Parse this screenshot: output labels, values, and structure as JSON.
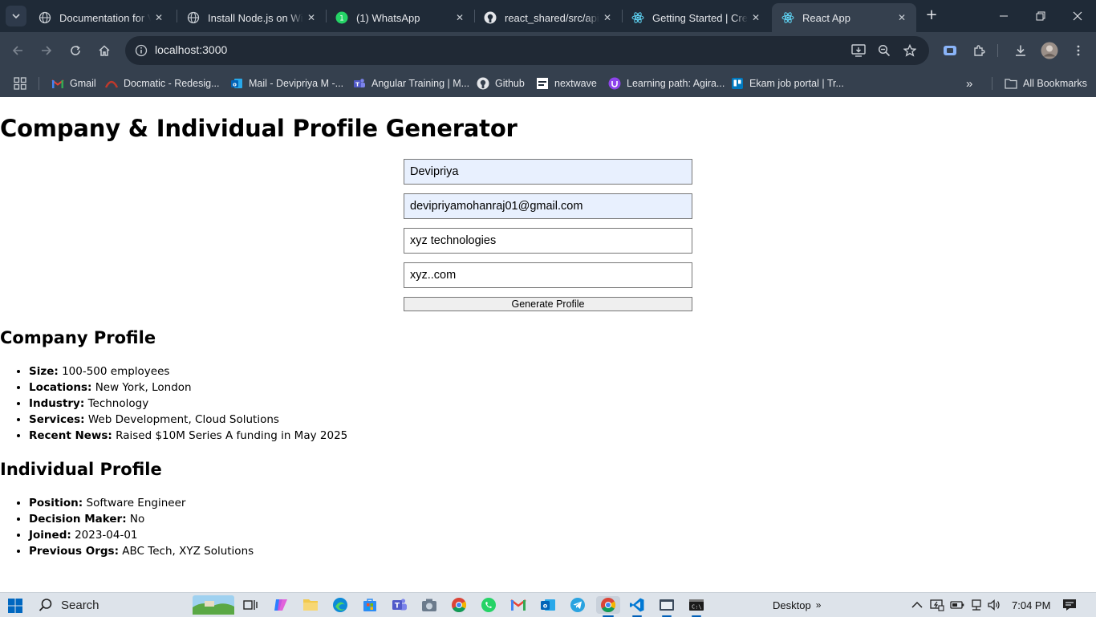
{
  "browser": {
    "tabs": [
      {
        "title": "Documentation for Visual Studio Code",
        "icon": "globe-icon"
      },
      {
        "title": "Install Node.js on Windows",
        "icon": "globe-icon"
      },
      {
        "title": "(1) WhatsApp",
        "icon": "whatsapp-icon",
        "badge": "1"
      },
      {
        "title": "react_shared/src/api/",
        "icon": "github-icon"
      },
      {
        "title": "Getting Started | Create React App",
        "icon": "react-icon"
      },
      {
        "title": "React App",
        "icon": "react-icon",
        "active": true
      }
    ],
    "url": "localhost:3000",
    "bookmarks": [
      {
        "label": "Gmail",
        "icon": "gmail-icon"
      },
      {
        "label": "Docmatic - Redesig...",
        "icon": "docmatic-icon"
      },
      {
        "label": "Mail - Devipriya M -...",
        "icon": "outlook-icon"
      },
      {
        "label": "Angular Training | M...",
        "icon": "teams-icon"
      },
      {
        "label": "Github",
        "icon": "github-icon"
      },
      {
        "label": "nextwave",
        "icon": "nextwave-icon"
      },
      {
        "label": "Learning path: Agira...",
        "icon": "learning-icon"
      },
      {
        "label": "Ekam job portal | Tr...",
        "icon": "trello-icon"
      }
    ],
    "all_bookmarks_label": "All Bookmarks"
  },
  "page": {
    "title": "Company & Individual Profile Generator",
    "form": {
      "name_value": "Devipriya",
      "email_value": "devipriyamohanraj01@gmail.com",
      "company_value": "xyz technologies",
      "domain_value": "xyz..com",
      "submit_label": "Generate Profile"
    },
    "company_profile": {
      "heading": "Company Profile",
      "items": [
        {
          "label": "Size:",
          "value": "100-500 employees"
        },
        {
          "label": "Locations:",
          "value": "New York, London"
        },
        {
          "label": "Industry:",
          "value": "Technology"
        },
        {
          "label": "Services:",
          "value": "Web Development, Cloud Solutions"
        },
        {
          "label": "Recent News:",
          "value": "Raised $10M Series A funding in May 2025"
        }
      ]
    },
    "individual_profile": {
      "heading": "Individual Profile",
      "items": [
        {
          "label": "Position:",
          "value": "Software Engineer"
        },
        {
          "label": "Decision Maker:",
          "value": "No"
        },
        {
          "label": "Joined:",
          "value": "2023-04-01"
        },
        {
          "label": "Previous Orgs:",
          "value": "ABC Tech, XYZ Solutions"
        }
      ]
    }
  },
  "taskbar": {
    "search_label": "Search",
    "desktop_label": "Desktop",
    "time": "7:04 PM"
  }
}
